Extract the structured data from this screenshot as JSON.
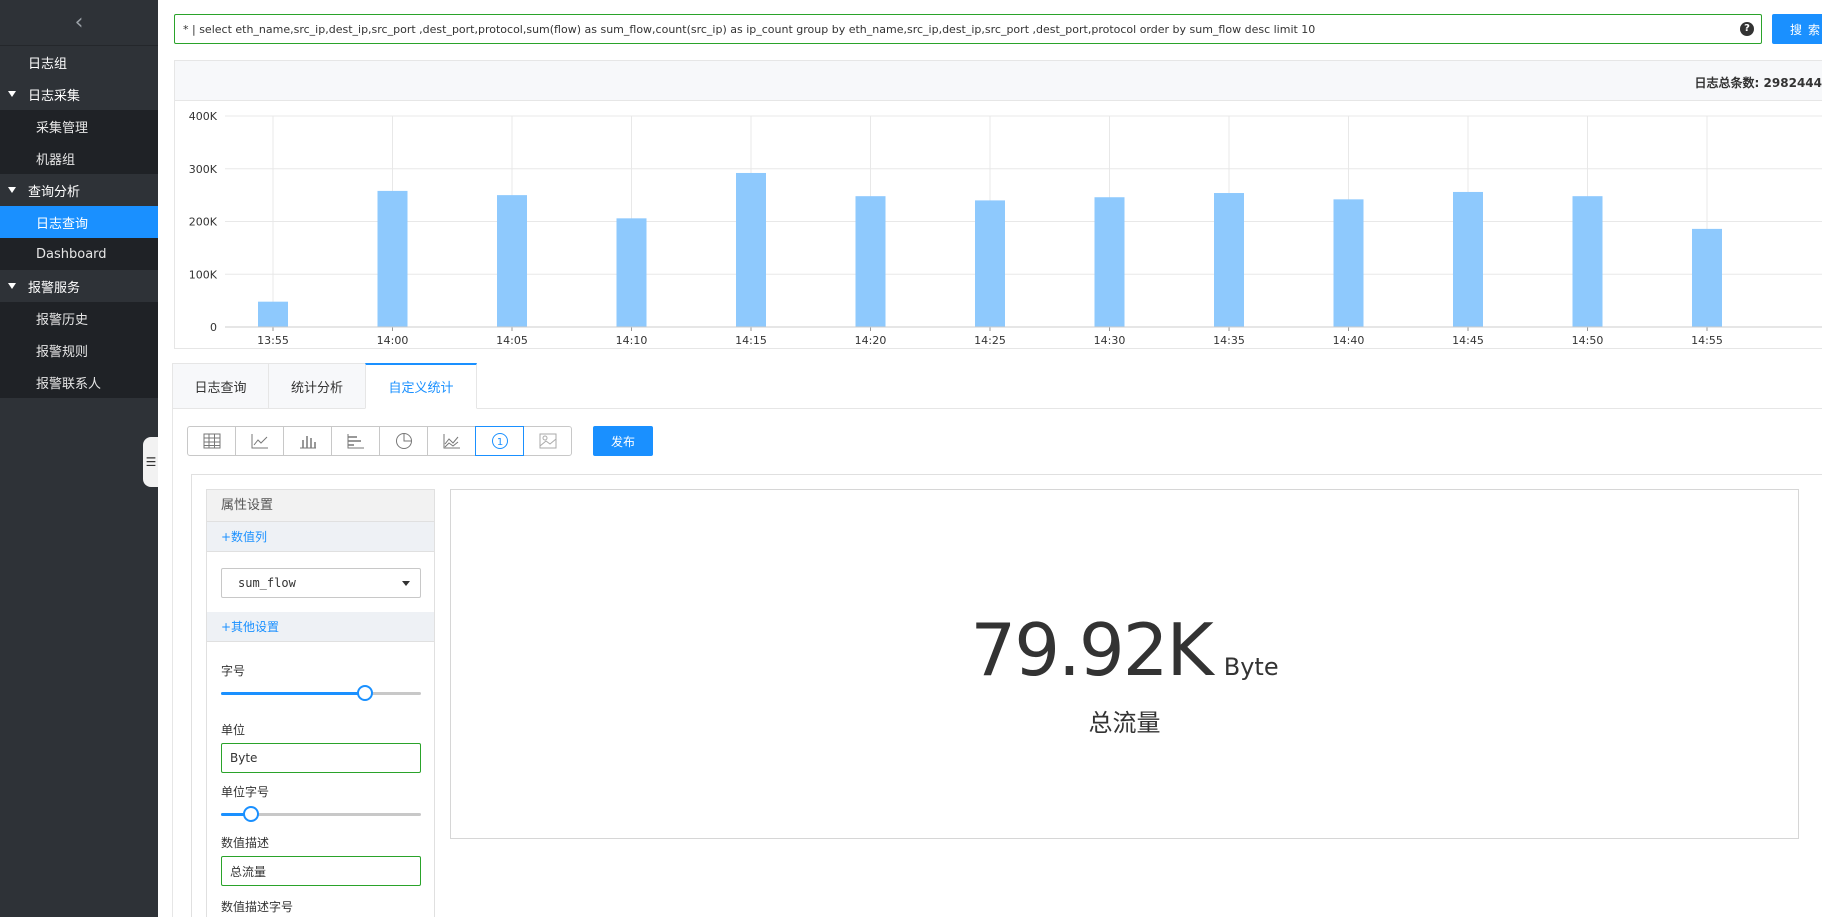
{
  "sidebar": {
    "items": [
      {
        "label": "日志组",
        "type": "top"
      },
      {
        "label": "日志采集",
        "type": "group"
      },
      {
        "label": "采集管理",
        "type": "sub"
      },
      {
        "label": "机器组",
        "type": "sub"
      },
      {
        "label": "查询分析",
        "type": "group"
      },
      {
        "label": "日志查询",
        "type": "sub",
        "active": true
      },
      {
        "label": "Dashboard",
        "type": "sub"
      },
      {
        "label": "报警服务",
        "type": "group"
      },
      {
        "label": "报警历史",
        "type": "sub"
      },
      {
        "label": "报警规则",
        "type": "sub"
      },
      {
        "label": "报警联系人",
        "type": "sub"
      }
    ]
  },
  "search": {
    "query": "* | select eth_name,src_ip,dest_ip,src_port ,dest_port,protocol,sum(flow) as sum_flow,count(src_ip) as ip_count group by eth_name,src_ip,dest_ip,src_port ,dest_port,protocol order by sum_flow desc limit 10",
    "help": "?",
    "button_label": "搜索"
  },
  "histogram": {
    "total_label": "日志总条数:",
    "total_value": "2982444"
  },
  "chart_data": {
    "type": "bar",
    "categories": [
      "13:55",
      "14:00",
      "14:05",
      "14:10",
      "14:15",
      "14:20",
      "14:25",
      "14:30",
      "14:35",
      "14:40",
      "14:45",
      "14:50",
      "14:55"
    ],
    "values": [
      48000,
      258000,
      250000,
      206000,
      292000,
      248000,
      240000,
      246000,
      254000,
      242000,
      256000,
      248000,
      186000
    ],
    "ylim": [
      0,
      400000
    ],
    "y_ticks": [
      "0",
      "100K",
      "200K",
      "300K",
      "400K"
    ],
    "grid": true,
    "color": "#8ec9fd"
  },
  "tabs": [
    {
      "label": "日志查询",
      "active": false
    },
    {
      "label": "统计分析",
      "active": false
    },
    {
      "label": "自定义统计",
      "active": true
    }
  ],
  "toolbar": {
    "tools": [
      {
        "icon": "table-icon",
        "active": false
      },
      {
        "icon": "line-chart-icon",
        "active": false
      },
      {
        "icon": "bar-chart-icon",
        "active": false
      },
      {
        "icon": "horizontal-bar-icon",
        "active": false
      },
      {
        "icon": "pie-chart-icon",
        "active": false
      },
      {
        "icon": "area-chart-icon",
        "active": false
      },
      {
        "icon": "number-display-icon",
        "active": true
      },
      {
        "icon": "map-icon",
        "active": false
      }
    ],
    "publish_label": "发布"
  },
  "attributes": {
    "title": "属性设置",
    "value_column_label": "+数值列",
    "selected_column": "sum_flow",
    "other_settings_label": "+其他设置",
    "font_size_label": "字号",
    "font_size_level": 0.72,
    "unit_label": "单位",
    "unit_value": "Byte",
    "unit_font_size_label": "单位字号",
    "unit_font_size_level": 0.15,
    "desc_label": "数值描述",
    "desc_value": "总流量",
    "desc_font_size_label": "数值描述字号"
  },
  "preview": {
    "value": "79.92K",
    "unit": "Byte",
    "desc": "总流量"
  },
  "colors": {
    "accent": "#1a90ff",
    "sidebar_bg": "#2e3237",
    "bar": "#8ec9fd",
    "input_border": "#2aa32a"
  }
}
